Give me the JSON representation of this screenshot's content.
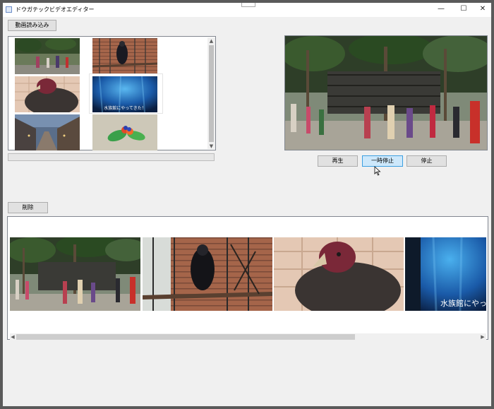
{
  "window": {
    "title": "ドウガテックビデオエディター",
    "minimize_glyph": "—",
    "maximize_glyph": "☐",
    "close_glyph": "✕"
  },
  "toolbar": {
    "load_label": "動画読み込み",
    "delete_label": "削除"
  },
  "player": {
    "play_label": "再生",
    "pause_label": "一時停止",
    "stop_label": "停止",
    "active_button": "pause"
  },
  "library": {
    "thumbnails": [
      {
        "subject": "zoo-crowd"
      },
      {
        "subject": "bird-in-cage"
      },
      {
        "subject": "vulture-closeup"
      },
      {
        "subject": "aquarium",
        "caption": "水族館にやってきた！"
      },
      {
        "subject": "city-street"
      },
      {
        "subject": "lorikeets"
      }
    ],
    "selected_index": 3,
    "progress_percent": 0
  },
  "timeline": {
    "clips": [
      {
        "subject": "zoo-crowd"
      },
      {
        "subject": "bird-in-cage"
      },
      {
        "subject": "vulture-closeup"
      },
      {
        "subject": "aquarium",
        "caption": "水族館にやってき"
      }
    ]
  },
  "colors": {
    "accent": "#3c9fe0",
    "button_bg": "#e1e1e1",
    "window_bg": "#f0f0f0"
  }
}
